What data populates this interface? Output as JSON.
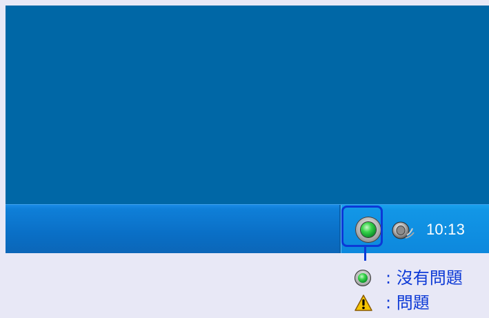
{
  "tray": {
    "clock": "10:13"
  },
  "legend": {
    "items": [
      {
        "icon": "status-ok-icon",
        "text": ": 沒有問題"
      },
      {
        "icon": "warning-icon",
        "text": ": 問題"
      }
    ]
  },
  "colors": {
    "desktop_background": "#0067a6",
    "taskbar": "#0b6fc6",
    "highlight": "#0c39d6",
    "status_ok": "#38d44a",
    "warning": "#f5c400"
  }
}
